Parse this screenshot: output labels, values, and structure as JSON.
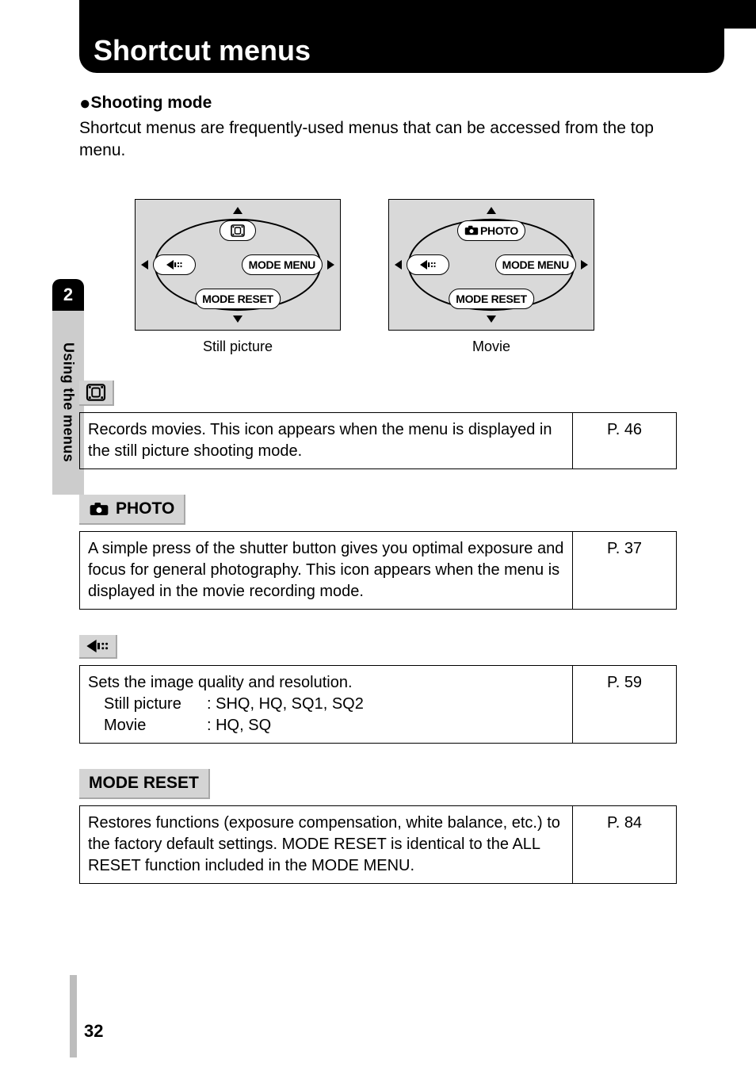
{
  "page": {
    "number": "32",
    "chapter_number": "2",
    "chapter_title": "Using the menus",
    "title": "Shortcut menus",
    "shooting_mode_label": "Shooting mode",
    "intro": "Shortcut menus are frequently-used menus that can be accessed from the top menu."
  },
  "diagrams": {
    "still": {
      "caption": "Still picture",
      "top_label": "",
      "left_label": "",
      "right_label": "MODE MENU",
      "bottom_label": "MODE RESET"
    },
    "movie": {
      "caption": "Movie",
      "top_label": "PHOTO",
      "left_label": "",
      "right_label": "MODE MENU",
      "bottom_label": "MODE RESET"
    }
  },
  "sections": {
    "movie": {
      "heading_icon": "movie-icon",
      "desc": "Records movies. This icon appears when the menu is displayed in the still picture shooting mode.",
      "ref": "P. 46"
    },
    "photo": {
      "heading_text": "PHOTO",
      "desc": "A simple press of the shutter button gives you optimal exposure and focus for general photography. This icon appears when the menu is displayed in the movie recording mode.",
      "ref": "P. 37"
    },
    "quality": {
      "heading_icon": "record-mode-icon",
      "line1": "Sets the image quality and resolution.",
      "still_label": "Still picture",
      "still_values": ": SHQ, HQ, SQ1, SQ2",
      "movie_label": "Movie",
      "movie_values": ": HQ, SQ",
      "ref": "P. 59"
    },
    "mode_reset": {
      "heading_text": "MODE RESET",
      "desc": "Restores functions (exposure compensation, white balance, etc.) to the factory default settings. MODE RESET is identical to the ALL RESET function included in the MODE MENU.",
      "ref": "P. 84"
    }
  }
}
